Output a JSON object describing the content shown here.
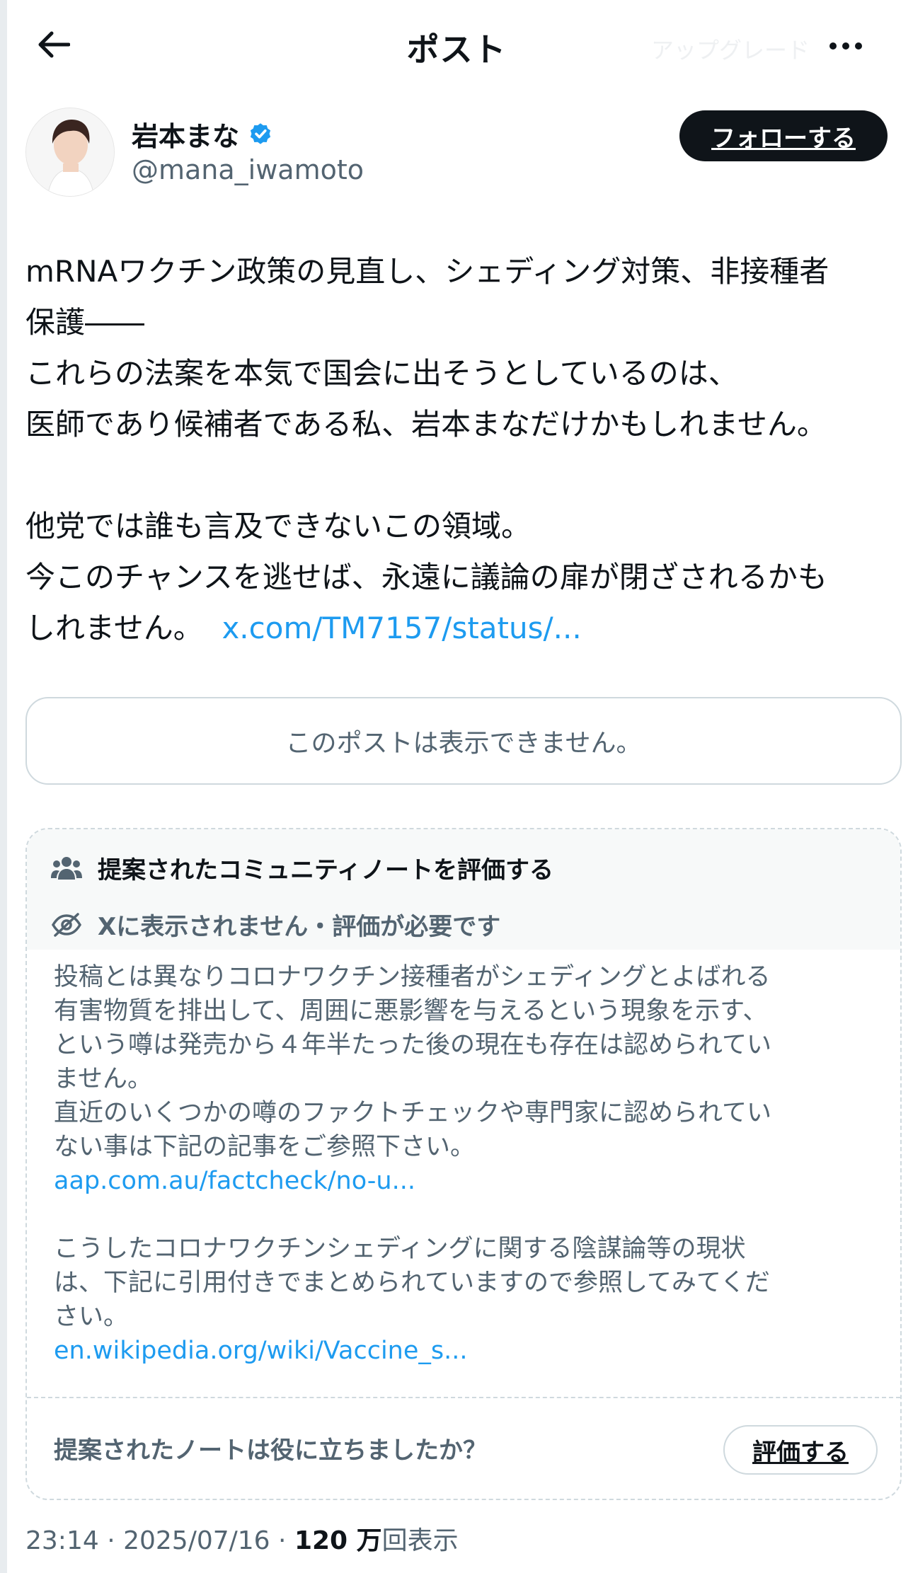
{
  "header": {
    "title": "ポスト",
    "ghost_text": "アップグレード"
  },
  "author": {
    "name": "岩本まな",
    "handle": "@mana_iwamoto",
    "follow_label": "フォローする"
  },
  "post": {
    "lines": [
      "mRNAワクチン政策の見直し、シェディング対策、非接種者",
      "保護――",
      "これらの法案を本気で国会に出そうとしているのは、",
      "医師であり候補者である私、岩本まなだけかもしれません。",
      "他党では誰も言及できないこの領域。",
      "今このチャンスを逃せば、永遠に議論の扉が閉ざされるかも",
      "しれません。"
    ],
    "link": "x.com/TM7157/status/..."
  },
  "quoted_post": {
    "unavailable_text": "このポストは表示できません。"
  },
  "community_note": {
    "title": "提案されたコミュニティノートを評価する",
    "status": "Xに表示されません・評価が必要です",
    "body_lines_1": [
      "投稿とは異なりコロナワクチン接種者がシェディングとよばれる",
      "有害物質を排出して、周囲に悪影響を与えるという現象を示す、",
      "という噂は発売から４年半たった後の現在も存在は認められてい",
      "ません。",
      "直近のいくつかの噂のファクトチェックや専門家に認められてい",
      "ない事は下記の記事をご参照下さい。"
    ],
    "link_1": "aap.com.au/factcheck/no-u...",
    "body_lines_2": [
      "こうしたコロナワクチンシェディングに関する陰謀論等の現状",
      "は、下記に引用付きでまとめられていますので参照してみてくだ",
      "さい。"
    ],
    "link_2": "en.wikipedia.org/wiki/Vaccine_s...",
    "question": "提案されたノートは役に立ちましたか？",
    "rate_label": "評価する"
  },
  "meta": {
    "time": "23:14",
    "date": "2025/07/16",
    "views_number": "120 万",
    "views_label": "回表示"
  },
  "colors": {
    "accent": "#1d9bf0",
    "text": "#0f1419",
    "secondary": "#536471",
    "border": "#cfd9de"
  }
}
